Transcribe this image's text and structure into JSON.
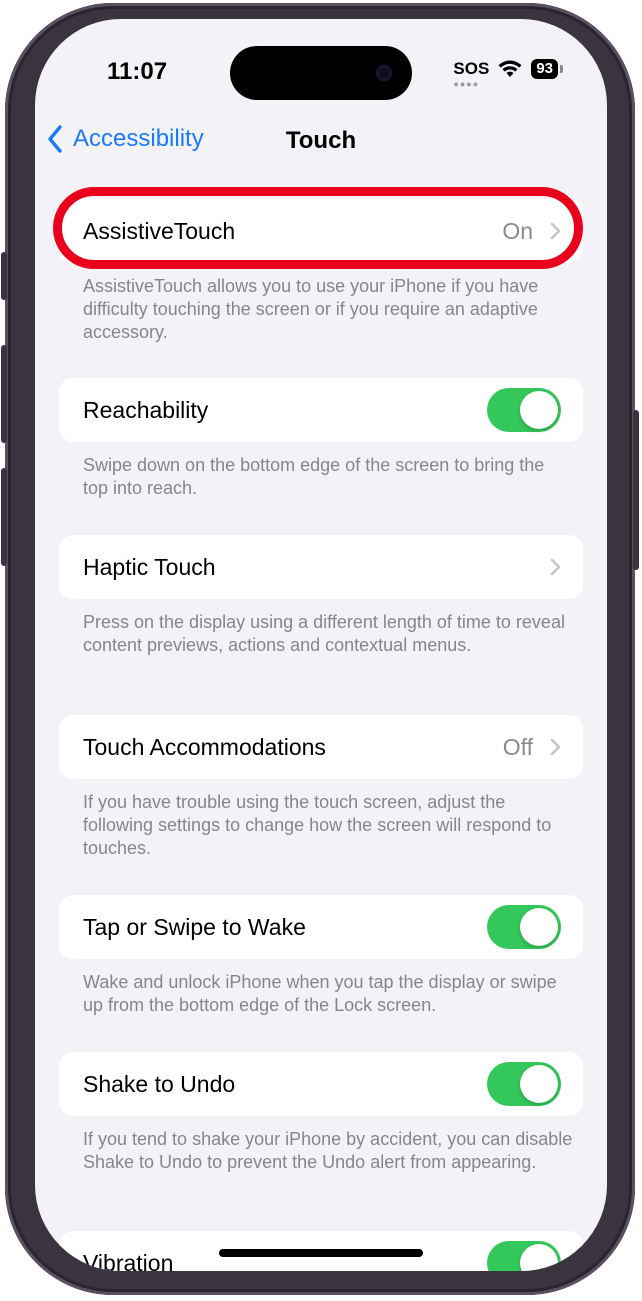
{
  "status_bar": {
    "time": "11:07",
    "sos": "SOS",
    "battery": "93"
  },
  "nav": {
    "back_label": "Accessibility",
    "title": "Touch"
  },
  "rows": [
    {
      "label": "AssistiveTouch",
      "value": "On",
      "footer": "AssistiveTouch allows you to use your iPhone if you have difficulty touching the screen or if you require an adaptive accessory."
    },
    {
      "label": "Reachability",
      "toggle": true,
      "footer": "Swipe down on the bottom edge of the screen to bring the top into reach."
    },
    {
      "label": "Haptic Touch",
      "footer": "Press on the display using a different length of time to reveal content previews, actions and contextual menus."
    },
    {
      "label": "Touch Accommodations",
      "value": "Off",
      "footer": "If you have trouble using the touch screen, adjust the following settings to change how the screen will respond to touches."
    },
    {
      "label": "Tap or Swipe to Wake",
      "toggle": true,
      "footer": "Wake and unlock iPhone when you tap the display or swipe up from the bottom edge of the Lock screen."
    },
    {
      "label": "Shake to Undo",
      "toggle": true,
      "footer": "If you tend to shake your iPhone by accident, you can disable Shake to Undo to prevent the Undo alert from appearing."
    },
    {
      "label": "Vibration",
      "toggle": true
    }
  ],
  "colors": {
    "accent": "#1a7af8",
    "toggle_on": "#34c759",
    "highlight": "#e8001c",
    "background": "#f2f2f7"
  },
  "icons": {
    "back": "chevron-left-icon",
    "disclosure": "chevron-right-icon",
    "wifi": "wifi-icon",
    "battery": "battery-icon"
  }
}
